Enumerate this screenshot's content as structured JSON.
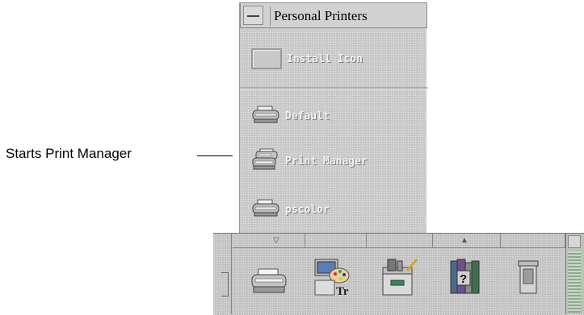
{
  "callout": {
    "label": "Starts Print Manager"
  },
  "subpanel": {
    "title": "Personal Printers",
    "install_label": "Install Icon",
    "items": [
      {
        "label": "Default",
        "icon": "printer-icon"
      },
      {
        "label": "Print Manager",
        "icon": "print-manager-icon"
      },
      {
        "label": "pscolor",
        "icon": "printer-icon"
      }
    ]
  },
  "frontpanel": {
    "icons": [
      "printer-icon",
      "style-manager-icon",
      "application-manager-icon",
      "help-manager-icon",
      "trash-icon"
    ]
  }
}
